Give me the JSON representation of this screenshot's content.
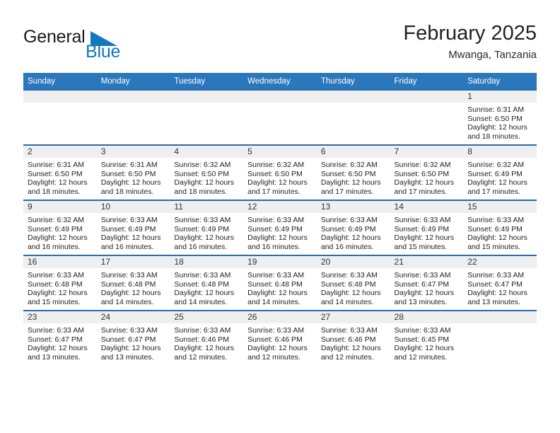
{
  "brand": {
    "name_part1": "General",
    "name_part2": "Blue",
    "triangle_icon": "triangle-right-icon",
    "accent_color": "#1277bf"
  },
  "header": {
    "title": "February 2025",
    "subtitle": "Mwanga, Tanzania"
  },
  "theme": {
    "header_bg": "#2b77bc",
    "row_border": "#2b6ca8",
    "day_band_bg": "#efefef",
    "page_bg": "#ffffff"
  },
  "weekdays": [
    "Sunday",
    "Monday",
    "Tuesday",
    "Wednesday",
    "Thursday",
    "Friday",
    "Saturday"
  ],
  "labels": {
    "sunrise_prefix": "Sunrise:",
    "sunset_prefix": "Sunset:",
    "daylight_prefix": "Daylight:"
  },
  "weeks": [
    [
      {
        "day": "",
        "sunrise": "",
        "sunset": "",
        "daylight_line1": "",
        "daylight_line2": "",
        "empty": true
      },
      {
        "day": "",
        "sunrise": "",
        "sunset": "",
        "daylight_line1": "",
        "daylight_line2": "",
        "empty": true
      },
      {
        "day": "",
        "sunrise": "",
        "sunset": "",
        "daylight_line1": "",
        "daylight_line2": "",
        "empty": true
      },
      {
        "day": "",
        "sunrise": "",
        "sunset": "",
        "daylight_line1": "",
        "daylight_line2": "",
        "empty": true
      },
      {
        "day": "",
        "sunrise": "",
        "sunset": "",
        "daylight_line1": "",
        "daylight_line2": "",
        "empty": true
      },
      {
        "day": "",
        "sunrise": "",
        "sunset": "",
        "daylight_line1": "",
        "daylight_line2": "",
        "empty": true
      },
      {
        "day": "1",
        "sunrise": "Sunrise: 6:31 AM",
        "sunset": "Sunset: 6:50 PM",
        "daylight_line1": "Daylight: 12 hours",
        "daylight_line2": "and 18 minutes.",
        "empty": false
      }
    ],
    [
      {
        "day": "2",
        "sunrise": "Sunrise: 6:31 AM",
        "sunset": "Sunset: 6:50 PM",
        "daylight_line1": "Daylight: 12 hours",
        "daylight_line2": "and 18 minutes.",
        "empty": false
      },
      {
        "day": "3",
        "sunrise": "Sunrise: 6:31 AM",
        "sunset": "Sunset: 6:50 PM",
        "daylight_line1": "Daylight: 12 hours",
        "daylight_line2": "and 18 minutes.",
        "empty": false
      },
      {
        "day": "4",
        "sunrise": "Sunrise: 6:32 AM",
        "sunset": "Sunset: 6:50 PM",
        "daylight_line1": "Daylight: 12 hours",
        "daylight_line2": "and 18 minutes.",
        "empty": false
      },
      {
        "day": "5",
        "sunrise": "Sunrise: 6:32 AM",
        "sunset": "Sunset: 6:50 PM",
        "daylight_line1": "Daylight: 12 hours",
        "daylight_line2": "and 17 minutes.",
        "empty": false
      },
      {
        "day": "6",
        "sunrise": "Sunrise: 6:32 AM",
        "sunset": "Sunset: 6:50 PM",
        "daylight_line1": "Daylight: 12 hours",
        "daylight_line2": "and 17 minutes.",
        "empty": false
      },
      {
        "day": "7",
        "sunrise": "Sunrise: 6:32 AM",
        "sunset": "Sunset: 6:50 PM",
        "daylight_line1": "Daylight: 12 hours",
        "daylight_line2": "and 17 minutes.",
        "empty": false
      },
      {
        "day": "8",
        "sunrise": "Sunrise: 6:32 AM",
        "sunset": "Sunset: 6:49 PM",
        "daylight_line1": "Daylight: 12 hours",
        "daylight_line2": "and 17 minutes.",
        "empty": false
      }
    ],
    [
      {
        "day": "9",
        "sunrise": "Sunrise: 6:32 AM",
        "sunset": "Sunset: 6:49 PM",
        "daylight_line1": "Daylight: 12 hours",
        "daylight_line2": "and 16 minutes.",
        "empty": false
      },
      {
        "day": "10",
        "sunrise": "Sunrise: 6:33 AM",
        "sunset": "Sunset: 6:49 PM",
        "daylight_line1": "Daylight: 12 hours",
        "daylight_line2": "and 16 minutes.",
        "empty": false
      },
      {
        "day": "11",
        "sunrise": "Sunrise: 6:33 AM",
        "sunset": "Sunset: 6:49 PM",
        "daylight_line1": "Daylight: 12 hours",
        "daylight_line2": "and 16 minutes.",
        "empty": false
      },
      {
        "day": "12",
        "sunrise": "Sunrise: 6:33 AM",
        "sunset": "Sunset: 6:49 PM",
        "daylight_line1": "Daylight: 12 hours",
        "daylight_line2": "and 16 minutes.",
        "empty": false
      },
      {
        "day": "13",
        "sunrise": "Sunrise: 6:33 AM",
        "sunset": "Sunset: 6:49 PM",
        "daylight_line1": "Daylight: 12 hours",
        "daylight_line2": "and 16 minutes.",
        "empty": false
      },
      {
        "day": "14",
        "sunrise": "Sunrise: 6:33 AM",
        "sunset": "Sunset: 6:49 PM",
        "daylight_line1": "Daylight: 12 hours",
        "daylight_line2": "and 15 minutes.",
        "empty": false
      },
      {
        "day": "15",
        "sunrise": "Sunrise: 6:33 AM",
        "sunset": "Sunset: 6:49 PM",
        "daylight_line1": "Daylight: 12 hours",
        "daylight_line2": "and 15 minutes.",
        "empty": false
      }
    ],
    [
      {
        "day": "16",
        "sunrise": "Sunrise: 6:33 AM",
        "sunset": "Sunset: 6:48 PM",
        "daylight_line1": "Daylight: 12 hours",
        "daylight_line2": "and 15 minutes.",
        "empty": false
      },
      {
        "day": "17",
        "sunrise": "Sunrise: 6:33 AM",
        "sunset": "Sunset: 6:48 PM",
        "daylight_line1": "Daylight: 12 hours",
        "daylight_line2": "and 14 minutes.",
        "empty": false
      },
      {
        "day": "18",
        "sunrise": "Sunrise: 6:33 AM",
        "sunset": "Sunset: 6:48 PM",
        "daylight_line1": "Daylight: 12 hours",
        "daylight_line2": "and 14 minutes.",
        "empty": false
      },
      {
        "day": "19",
        "sunrise": "Sunrise: 6:33 AM",
        "sunset": "Sunset: 6:48 PM",
        "daylight_line1": "Daylight: 12 hours",
        "daylight_line2": "and 14 minutes.",
        "empty": false
      },
      {
        "day": "20",
        "sunrise": "Sunrise: 6:33 AM",
        "sunset": "Sunset: 6:48 PM",
        "daylight_line1": "Daylight: 12 hours",
        "daylight_line2": "and 14 minutes.",
        "empty": false
      },
      {
        "day": "21",
        "sunrise": "Sunrise: 6:33 AM",
        "sunset": "Sunset: 6:47 PM",
        "daylight_line1": "Daylight: 12 hours",
        "daylight_line2": "and 13 minutes.",
        "empty": false
      },
      {
        "day": "22",
        "sunrise": "Sunrise: 6:33 AM",
        "sunset": "Sunset: 6:47 PM",
        "daylight_line1": "Daylight: 12 hours",
        "daylight_line2": "and 13 minutes.",
        "empty": false
      }
    ],
    [
      {
        "day": "23",
        "sunrise": "Sunrise: 6:33 AM",
        "sunset": "Sunset: 6:47 PM",
        "daylight_line1": "Daylight: 12 hours",
        "daylight_line2": "and 13 minutes.",
        "empty": false
      },
      {
        "day": "24",
        "sunrise": "Sunrise: 6:33 AM",
        "sunset": "Sunset: 6:47 PM",
        "daylight_line1": "Daylight: 12 hours",
        "daylight_line2": "and 13 minutes.",
        "empty": false
      },
      {
        "day": "25",
        "sunrise": "Sunrise: 6:33 AM",
        "sunset": "Sunset: 6:46 PM",
        "daylight_line1": "Daylight: 12 hours",
        "daylight_line2": "and 12 minutes.",
        "empty": false
      },
      {
        "day": "26",
        "sunrise": "Sunrise: 6:33 AM",
        "sunset": "Sunset: 6:46 PM",
        "daylight_line1": "Daylight: 12 hours",
        "daylight_line2": "and 12 minutes.",
        "empty": false
      },
      {
        "day": "27",
        "sunrise": "Sunrise: 6:33 AM",
        "sunset": "Sunset: 6:46 PM",
        "daylight_line1": "Daylight: 12 hours",
        "daylight_line2": "and 12 minutes.",
        "empty": false
      },
      {
        "day": "28",
        "sunrise": "Sunrise: 6:33 AM",
        "sunset": "Sunset: 6:45 PM",
        "daylight_line1": "Daylight: 12 hours",
        "daylight_line2": "and 12 minutes.",
        "empty": false
      },
      {
        "day": "",
        "sunrise": "",
        "sunset": "",
        "daylight_line1": "",
        "daylight_line2": "",
        "empty": true
      }
    ]
  ]
}
